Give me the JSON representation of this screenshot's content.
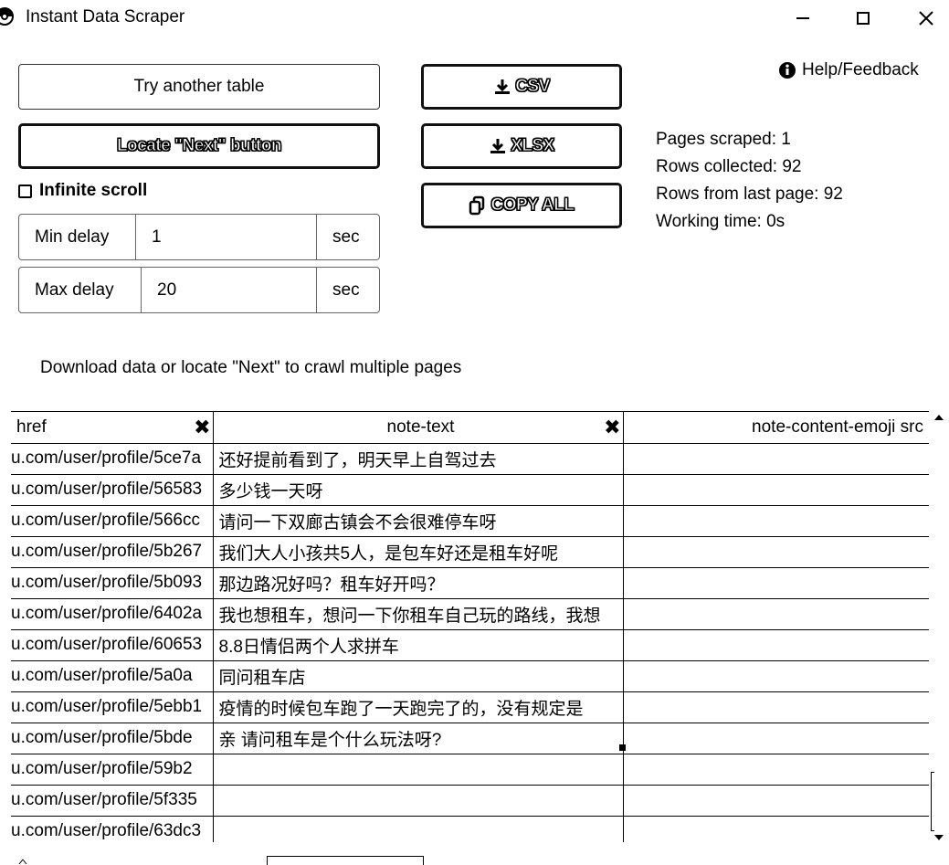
{
  "window": {
    "title": "Instant Data Scraper",
    "minimize_icon": "minimize-icon",
    "maximize_icon": "maximize-icon",
    "close_icon": "close-icon"
  },
  "controls": {
    "try_another_label": "Try another table",
    "locate_next_label": "Locate \"Next\" button",
    "infinite_scroll_label": "Infinite scroll",
    "infinite_scroll_checked": false,
    "min_delay_label": "Min delay",
    "min_delay_value": "1",
    "max_delay_label": "Max delay",
    "max_delay_value": "20",
    "delay_unit": "sec"
  },
  "exports": {
    "csv_label": "CSV",
    "xlsx_label": "XLSX",
    "copy_label": "COPY ALL"
  },
  "help": {
    "label": "Help/Feedback"
  },
  "stats": {
    "pages": "Pages scraped: 1",
    "rows": "Rows collected: 92",
    "last_page": "Rows from last page: 92",
    "time": "Working time: 0s"
  },
  "hint": "Download data or locate \"Next\" to crawl multiple pages",
  "table": {
    "columns": [
      "href",
      "note-text",
      "note-content-emoji src"
    ],
    "rows": [
      {
        "href": "u.com/user/profile/5ce7a",
        "note": "还好提前看到了，明天早上自驾过去",
        "emoji": ""
      },
      {
        "href": "u.com/user/profile/56583",
        "note": "多少钱一天呀",
        "emoji": ""
      },
      {
        "href": "u.com/user/profile/566cc",
        "note": "请问一下双廊古镇会不会很难停车呀",
        "emoji": ""
      },
      {
        "href": "u.com/user/profile/5b267",
        "note": "我们大人小孩共5人，是包车好还是租车好呢",
        "emoji": ""
      },
      {
        "href": "u.com/user/profile/5b093",
        "note": "那边路况好吗？租车好开吗？",
        "emoji": ""
      },
      {
        "href": "u.com/user/profile/6402a",
        "note": "我也想租车，想问一下你租车自己玩的路线，我想",
        "emoji": ""
      },
      {
        "href": "u.com/user/profile/60653",
        "note": "8.8日情侣两个人求拼车",
        "emoji": ""
      },
      {
        "href": "u.com/user/profile/5a0a",
        "note": "同问租车店",
        "emoji": ""
      },
      {
        "href": "u.com/user/profile/5ebb1",
        "note": "疫情的时候包车跑了一天跑完了的，没有规定是",
        "emoji": ""
      },
      {
        "href": "u.com/user/profile/5bde",
        "note": "亲 请问租车是个什么玩法呀?",
        "emoji": ""
      },
      {
        "href": "u.com/user/profile/59b2",
        "note": "",
        "emoji": ""
      },
      {
        "href": "u.com/user/profile/5f335",
        "note": "",
        "emoji": ""
      },
      {
        "href": "u.com/user/profile/63dc3",
        "note": "",
        "emoji": ""
      }
    ]
  }
}
